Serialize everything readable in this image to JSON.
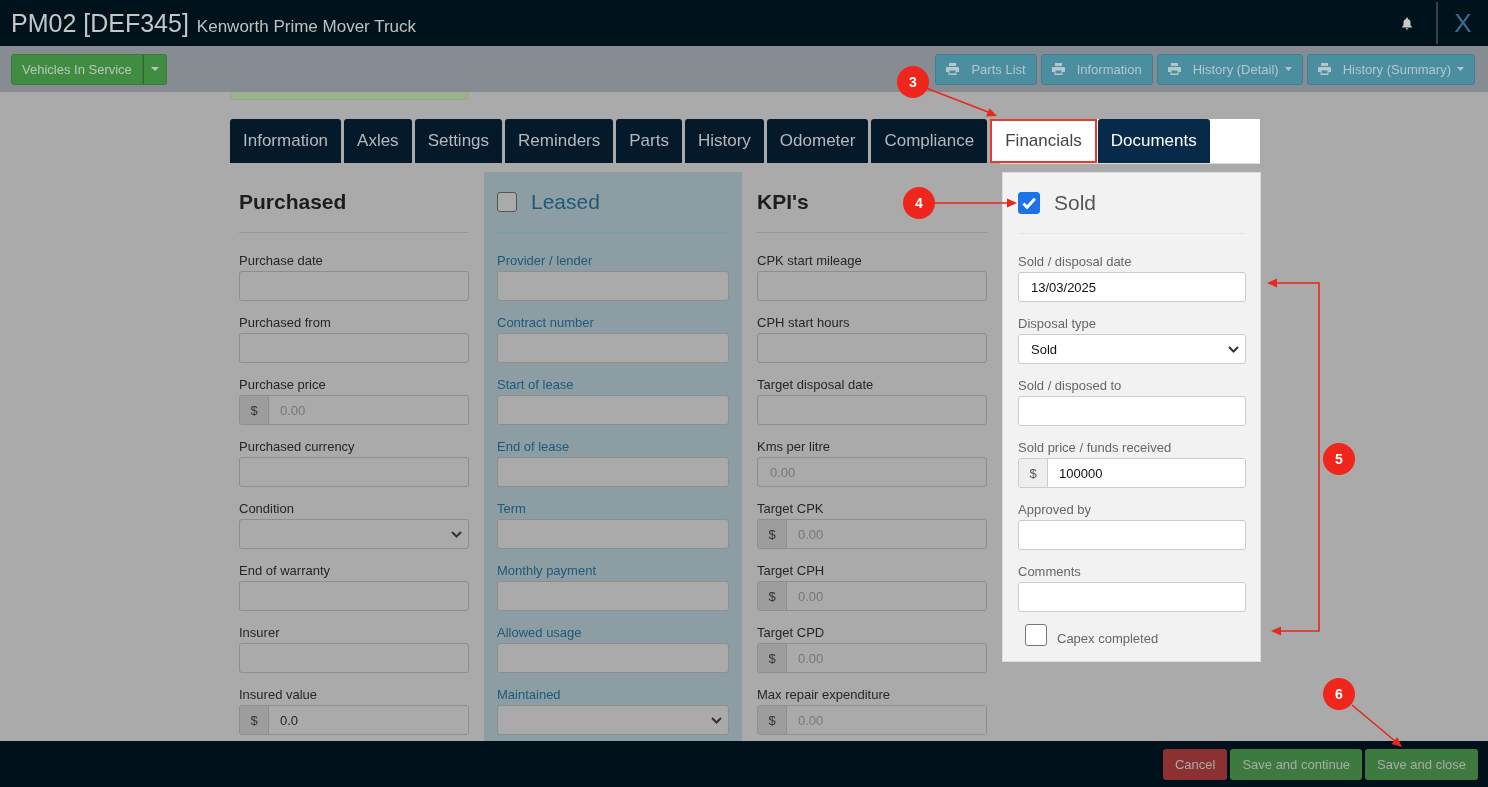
{
  "header": {
    "title": "PM02 [DEF345]",
    "subtitle": "Kenworth Prime Mover Truck",
    "close": "X"
  },
  "toolbar": {
    "status_button": "Vehicles In Service",
    "print_buttons": [
      {
        "label": "Parts List",
        "dropdown": false
      },
      {
        "label": "Information",
        "dropdown": false
      },
      {
        "label": "History (Detail)",
        "dropdown": true
      },
      {
        "label": "History (Summary)",
        "dropdown": true
      }
    ]
  },
  "tabs": [
    {
      "label": "Information",
      "selected": false,
      "highlighted": false
    },
    {
      "label": "Axles",
      "selected": false,
      "highlighted": false
    },
    {
      "label": "Settings",
      "selected": false,
      "highlighted": false
    },
    {
      "label": "Reminders",
      "selected": false,
      "highlighted": false
    },
    {
      "label": "Parts",
      "selected": false,
      "highlighted": false
    },
    {
      "label": "History",
      "selected": false,
      "highlighted": false
    },
    {
      "label": "Odometer",
      "selected": false,
      "highlighted": false
    },
    {
      "label": "Compliance",
      "selected": false,
      "highlighted": false
    },
    {
      "label": "Financials",
      "selected": true,
      "highlighted": true
    },
    {
      "label": "Documents",
      "selected": false,
      "highlighted": true
    }
  ],
  "purchased": {
    "title": "Purchased",
    "fields": [
      {
        "label": "Purchase date",
        "kind": "text"
      },
      {
        "label": "Purchased from",
        "kind": "text"
      },
      {
        "label": "Purchase price",
        "kind": "currency",
        "addon": "$",
        "placeholder": "0.00"
      },
      {
        "label": "Purchased currency",
        "kind": "text"
      },
      {
        "label": "Condition",
        "kind": "select"
      },
      {
        "label": "End of warranty",
        "kind": "text"
      },
      {
        "label": "Insurer",
        "kind": "text"
      },
      {
        "label": "Insured value",
        "kind": "currency",
        "addon": "$",
        "value": "0.0"
      }
    ]
  },
  "leased": {
    "title": "Leased",
    "checked": false,
    "fields": [
      {
        "label": "Provider / lender",
        "kind": "text"
      },
      {
        "label": "Contract number",
        "kind": "text"
      },
      {
        "label": "Start of lease",
        "kind": "text"
      },
      {
        "label": "End of lease",
        "kind": "text"
      },
      {
        "label": "Term",
        "kind": "text"
      },
      {
        "label": "Monthly payment",
        "kind": "text"
      },
      {
        "label": "Allowed usage",
        "kind": "text"
      },
      {
        "label": "Maintained",
        "kind": "select"
      }
    ]
  },
  "kpis": {
    "title": "KPI's",
    "fields": [
      {
        "label": "CPK start mileage",
        "kind": "text"
      },
      {
        "label": "CPH start hours",
        "kind": "text"
      },
      {
        "label": "Target disposal date",
        "kind": "text"
      },
      {
        "label": "Kms per litre",
        "kind": "text",
        "placeholder": "0.00"
      },
      {
        "label": "Target CPK",
        "kind": "currency",
        "addon": "$",
        "placeholder": "0.00"
      },
      {
        "label": "Target CPH",
        "kind": "currency",
        "addon": "$",
        "placeholder": "0.00"
      },
      {
        "label": "Target CPD",
        "kind": "currency",
        "addon": "$",
        "placeholder": "0.00"
      },
      {
        "label": "Max repair expenditure",
        "kind": "currency",
        "addon": "$",
        "placeholder": "0.00"
      }
    ]
  },
  "sold": {
    "title": "Sold",
    "checked": true,
    "fields": [
      {
        "label": "Sold / disposal date",
        "kind": "text",
        "value": "13/03/2025"
      },
      {
        "label": "Disposal type",
        "kind": "select",
        "value": "Sold"
      },
      {
        "label": "Sold / disposed to",
        "kind": "text"
      },
      {
        "label": "Sold price / funds received",
        "kind": "currency",
        "addon": "$",
        "value": "100000"
      },
      {
        "label": "Approved by",
        "kind": "text"
      },
      {
        "label": "Comments",
        "kind": "text"
      }
    ],
    "capex": {
      "label": "Capex completed",
      "checked": false
    }
  },
  "footer": {
    "buttons": [
      {
        "label": "Cancel",
        "kind": "danger"
      },
      {
        "label": "Save and continue",
        "kind": "success"
      },
      {
        "label": "Save and close",
        "kind": "success"
      }
    ]
  },
  "annotations": [
    {
      "number": "3"
    },
    {
      "number": "4"
    },
    {
      "number": "5"
    },
    {
      "number": "6"
    }
  ]
}
